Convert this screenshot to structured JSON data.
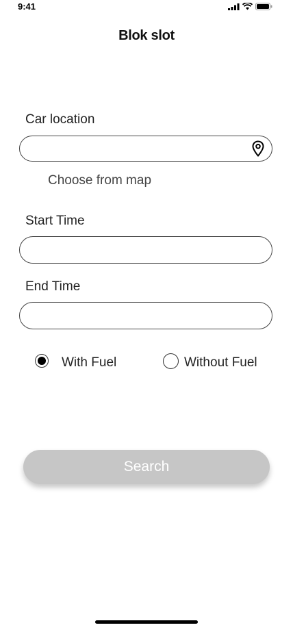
{
  "status_bar": {
    "time": "9:41"
  },
  "header": {
    "title": "Blok slot"
  },
  "form": {
    "car_location": {
      "label": "Car location",
      "value": "",
      "placeholder": "",
      "icon": "location-pin-icon"
    },
    "choose_from_map": "Choose from map",
    "start_time": {
      "label": "Start Time",
      "value": "",
      "placeholder": ""
    },
    "end_time": {
      "label": "End Time",
      "value": "",
      "placeholder": ""
    },
    "fuel_options": [
      {
        "label": "With Fuel",
        "selected": true
      },
      {
        "label": "Without Fuel",
        "selected": false
      }
    ],
    "search_label": "Search"
  },
  "colors": {
    "search_button": "#c6c6c6",
    "border": "#444444"
  }
}
